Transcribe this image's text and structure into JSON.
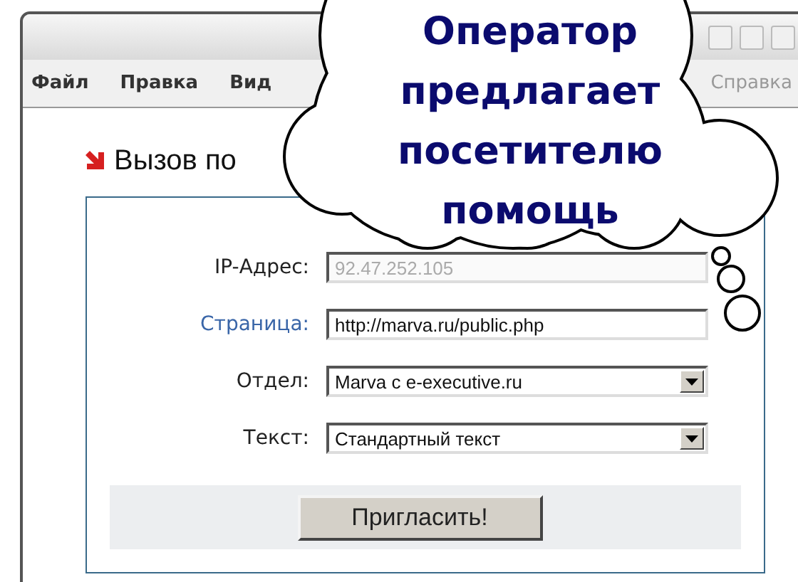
{
  "menu": [
    {
      "label": "Файл"
    },
    {
      "label": "Правка"
    },
    {
      "label": "Вид"
    },
    {
      "label": "Справка"
    }
  ],
  "heading": "Вызов по",
  "form": {
    "rows": [
      {
        "kind": "text",
        "label": "IP-Адрес:",
        "value": "92.47.252.105",
        "disabled": true,
        "link": false
      },
      {
        "kind": "text",
        "label": "Страница:",
        "value": "http://marva.ru/public.php",
        "disabled": false,
        "link": true
      },
      {
        "kind": "select",
        "label": "Отдел:",
        "value": "Marva с e-executive.ru",
        "disabled": false,
        "link": false
      },
      {
        "kind": "select",
        "label": "Текст:",
        "value": "Стандартный текст",
        "disabled": false,
        "link": false
      }
    ],
    "button": "Пригласить!"
  },
  "callout": {
    "lines": [
      "Оператор",
      "предлагает",
      "посетителю",
      "помощь"
    ]
  }
}
